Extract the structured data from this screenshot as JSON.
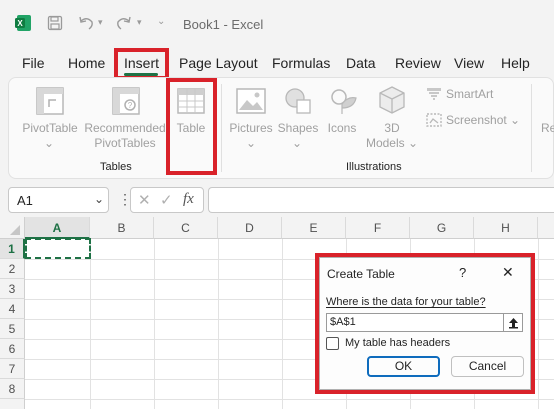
{
  "titlebar": {
    "app_icon": "excel-icon",
    "doc_title": "Book1  -  Excel"
  },
  "menu": [
    "File",
    "Home",
    "Insert",
    "Page Layout",
    "Formulas",
    "Data",
    "Review",
    "View",
    "Help"
  ],
  "ribbon": {
    "tables_group": "Tables",
    "illustrations_group": "Illustrations",
    "pivottable": "PivotTable",
    "recommended_1": "Recommended",
    "recommended_2": "PivotTables",
    "table": "Table",
    "pictures": "Pictures",
    "shapes": "Shapes",
    "icons": "Icons",
    "models_1": "3D",
    "models_2": "Models",
    "smartart": "SmartArt",
    "screenshot": "Screenshot",
    "cut_label": "Re"
  },
  "formula_bar": {
    "namebox": "A1",
    "fx": "fx",
    "value": ""
  },
  "columns": [
    "A",
    "B",
    "C",
    "D",
    "E",
    "F",
    "G",
    "H"
  ],
  "rows": [
    "1",
    "2",
    "3",
    "4",
    "5",
    "6",
    "7",
    "8"
  ],
  "dialog": {
    "title": "Create Table",
    "help": "?",
    "close": "✕",
    "question": "Where is the data for your table?",
    "range_value": "$A$1",
    "checkbox_label": "My table has headers",
    "checkbox_checked": false,
    "ok": "OK",
    "cancel": "Cancel"
  },
  "colors": {
    "accent_green": "#1e7145",
    "highlight_red": "#d9222a",
    "ok_blue": "#0f6cbd"
  }
}
